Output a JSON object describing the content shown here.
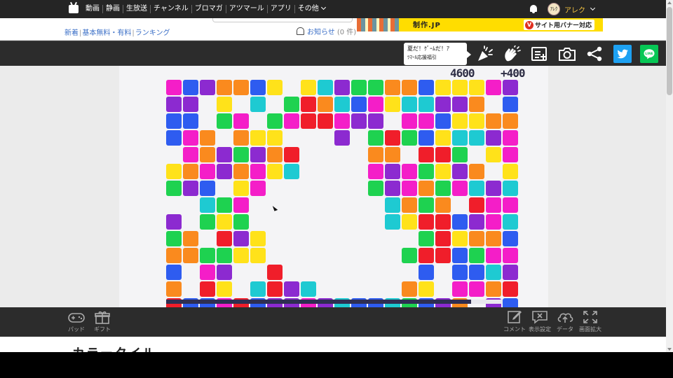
{
  "topnav": {
    "items": [
      "動画",
      "静画",
      "生放送",
      "チャンネル",
      "ブロマガ",
      "アツマール",
      "アプリ",
      "その他"
    ],
    "user_name": "アレク",
    "avatar_text": "ｱﾚｸ"
  },
  "subnav": {
    "links": [
      "新着",
      "基本無料・有料",
      "ランキング"
    ],
    "notice_label": "お知らせ",
    "notice_count": "(0 件)"
  },
  "banner": {
    "text_main": "制作.JP",
    "text_sub": "サイト用バナー対応",
    "logo_letter": "V"
  },
  "toolbar": {
    "bubble_line1": "夏だ！ｹﾞｰﾑだ！ｱ",
    "bubble_line2": "ﾂﾏｰﾙ応援福引"
  },
  "game": {
    "score": "4600",
    "bonus": "+400",
    "timer_progress": 0.906,
    "colors": {
      "m": "#f41ec8",
      "b": "#2e5cf0",
      "p": "#8c2ad0",
      "o": "#fa8a1e",
      "y": "#ffe21a",
      "c": "#1ecad2",
      "g": "#1ed250",
      "r": "#f01e2a"
    },
    "rows": [
      "mbpooby.ycpggoobyyymp",
      "pp.y.c.grocbmyccppo.b",
      "bb.gm.gmrrmpp.mmbyyoo",
      "bmo.oyy...p.grgbyccpm",
      ".mopgpor....oo.rrg.ym",
      "yompomyc....mpmgypo.y",
      "gpb.ym......gpmogmcpc",
      "..cgm........cogo.rmm",
      "p.gyg........cyrrbpmc",
      "go.rpy.........gryoob",
      "ooggyy........grrbgmm",
      "b.mp..r........b.bbcp",
      "o.ry.crpc.....oy.mmor",
      "rbbmrbppmpcbbcgbpo.pb"
    ]
  },
  "ctrl": {
    "pad_label": "パッド",
    "gift_label": "ギフト",
    "comment_label": "コメント",
    "display_label": "表示設定",
    "data_label": "データ",
    "zoom_label": "画面拡大"
  },
  "below": {
    "title": "カラータイル"
  }
}
